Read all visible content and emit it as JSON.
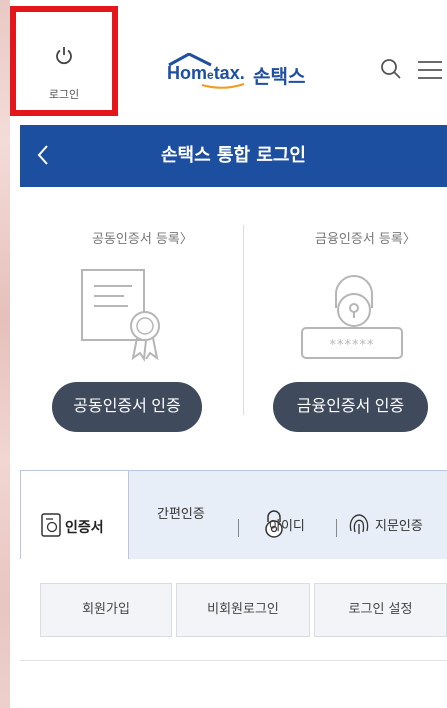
{
  "header": {
    "login_label": "로그인",
    "logo_en": "Hom",
    "logo_e": "e",
    "logo_en2": "tax.",
    "logo_kr": "손택스"
  },
  "titlebar": {
    "title": "손택스 통합 로그인"
  },
  "panels": {
    "joint": {
      "link": "공동인증서 등록〉",
      "button": "공동인증서 인증"
    },
    "finance": {
      "link": "금융인증서 등록〉",
      "button": "금융인증서 인증"
    }
  },
  "tabs": {
    "cert": "인증서",
    "simple": "간편인증",
    "id": "아이디",
    "fingerprint": "지문인증"
  },
  "actions": {
    "signup": "회원가입",
    "guest_login": "비회원로그인",
    "login_settings": "로그인 설정"
  },
  "colors": {
    "primary": "#1d4fa0",
    "pill": "#3f4a5c",
    "highlight": "#e3161b"
  }
}
